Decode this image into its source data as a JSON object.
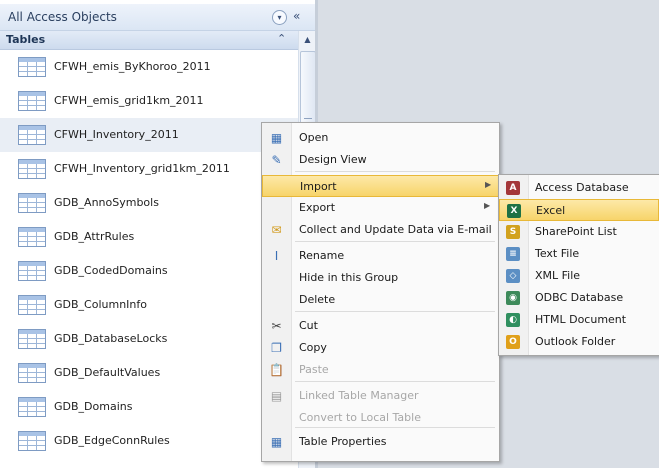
{
  "nav": {
    "title": "All Access Objects",
    "menu_icon": "chevron-down-circle-icon",
    "collapse_glyph": "«",
    "section_label": "Tables",
    "section_toggle": "⌃",
    "tables": [
      {
        "name": "CFWH_emis_ByKhoroo_2011",
        "selected": false
      },
      {
        "name": "CFWH_emis_grid1km_2011",
        "selected": false
      },
      {
        "name": "CFWH_Inventory_2011",
        "selected": true
      },
      {
        "name": "CFWH_Inventory_grid1km_2011",
        "selected": false
      },
      {
        "name": "GDB_AnnoSymbols",
        "selected": false
      },
      {
        "name": "GDB_AttrRules",
        "selected": false
      },
      {
        "name": "GDB_CodedDomains",
        "selected": false
      },
      {
        "name": "GDB_ColumnInfo",
        "selected": false
      },
      {
        "name": "GDB_DatabaseLocks",
        "selected": false
      },
      {
        "name": "GDB_DefaultValues",
        "selected": false
      },
      {
        "name": "GDB_Domains",
        "selected": false
      },
      {
        "name": "GDB_EdgeConnRules",
        "selected": false
      }
    ]
  },
  "context_menu": {
    "items": [
      {
        "label": "Open",
        "icon": "open-table-icon",
        "glyph": "▦",
        "color": "#3a6fb5",
        "disabled": false,
        "submenu": false,
        "highlighted": false
      },
      {
        "label": "Design View",
        "icon": "design-view-icon",
        "glyph": "✎",
        "color": "#3a6fb5",
        "disabled": false,
        "submenu": false,
        "highlighted": false
      },
      {
        "label": "Import",
        "icon": "",
        "glyph": "",
        "color": "",
        "disabled": false,
        "submenu": true,
        "highlighted": true
      },
      {
        "label": "Export",
        "icon": "",
        "glyph": "",
        "color": "",
        "disabled": false,
        "submenu": true,
        "highlighted": false
      },
      {
        "label": "Collect and Update Data via E-mail",
        "icon": "email-collect-icon",
        "glyph": "✉",
        "color": "#d29a1c",
        "disabled": false,
        "submenu": false,
        "highlighted": false
      },
      {
        "label": "Rename",
        "icon": "rename-icon",
        "glyph": "I",
        "color": "#3a6fb5",
        "disabled": false,
        "submenu": false,
        "highlighted": false
      },
      {
        "label": "Hide in this Group",
        "icon": "",
        "glyph": "",
        "color": "",
        "disabled": false,
        "submenu": false,
        "highlighted": false
      },
      {
        "label": "Delete",
        "icon": "",
        "glyph": "",
        "color": "",
        "disabled": false,
        "submenu": false,
        "highlighted": false
      },
      {
        "label": "Cut",
        "icon": "scissors-icon",
        "glyph": "✂",
        "color": "#444444",
        "disabled": false,
        "submenu": false,
        "highlighted": false
      },
      {
        "label": "Copy",
        "icon": "copy-icon",
        "glyph": "❐",
        "color": "#3a6fb5",
        "disabled": false,
        "submenu": false,
        "highlighted": false
      },
      {
        "label": "Paste",
        "icon": "paste-icon",
        "glyph": "📋",
        "color": "#9a9a9a",
        "disabled": true,
        "submenu": false,
        "highlighted": false
      },
      {
        "label": "Linked Table Manager",
        "icon": "linked-table-manager-icon",
        "glyph": "▤",
        "color": "#9a9a9a",
        "disabled": true,
        "submenu": false,
        "highlighted": false
      },
      {
        "label": "Convert to Local Table",
        "icon": "",
        "glyph": "",
        "color": "",
        "disabled": true,
        "submenu": false,
        "highlighted": false
      },
      {
        "label": "Table Properties",
        "icon": "table-properties-icon",
        "glyph": "▦",
        "color": "#3a6fb5",
        "disabled": false,
        "submenu": false,
        "highlighted": false
      }
    ]
  },
  "import_submenu": {
    "items": [
      {
        "label": "Access Database",
        "icon": "access-database-icon",
        "glyph": "A",
        "color": "#a4373a",
        "highlighted": false
      },
      {
        "label": "Excel",
        "icon": "excel-icon",
        "glyph": "X",
        "color": "#1e7145",
        "highlighted": true
      },
      {
        "label": "SharePoint List",
        "icon": "sharepoint-list-icon",
        "glyph": "S",
        "color": "#d2a21e",
        "highlighted": false
      },
      {
        "label": "Text File",
        "icon": "text-file-icon",
        "glyph": "≡",
        "color": "#5c8fc4",
        "highlighted": false
      },
      {
        "label": "XML File",
        "icon": "xml-file-icon",
        "glyph": "◇",
        "color": "#5c8fc4",
        "highlighted": false
      },
      {
        "label": "ODBC Database",
        "icon": "odbc-database-icon",
        "glyph": "◉",
        "color": "#3d8a5a",
        "highlighted": false
      },
      {
        "label": "HTML Document",
        "icon": "html-document-icon",
        "glyph": "◐",
        "color": "#2f8f5f",
        "highlighted": false
      },
      {
        "label": "Outlook Folder",
        "icon": "outlook-folder-icon",
        "glyph": "O",
        "color": "#e0a01a",
        "highlighted": false
      }
    ]
  }
}
